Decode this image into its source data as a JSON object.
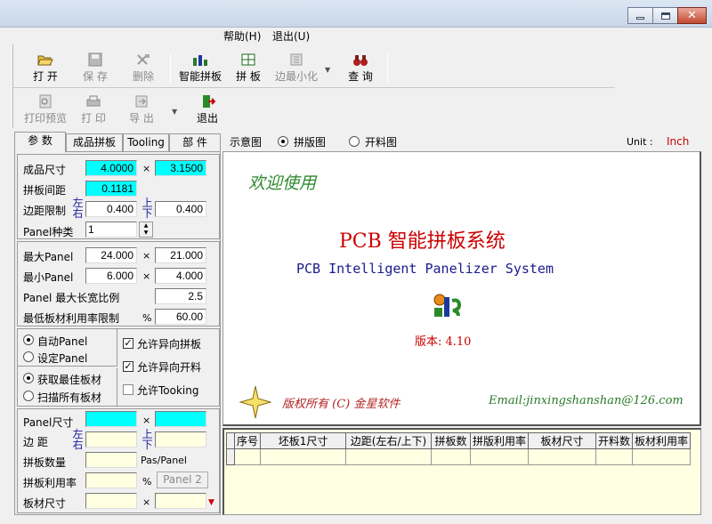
{
  "menu": {
    "help": "帮助(H)",
    "exit": "退出(U)"
  },
  "toolbar": {
    "open": "打 开",
    "save": "保 存",
    "delete": "删除",
    "smart_panel": "智能拼板",
    "panel": "拼 板",
    "edge_min": "边最小化",
    "query": "查 询",
    "print_preview": "打印预览",
    "print": "打 印",
    "export": "导 出",
    "exit": "退出"
  },
  "tabs": [
    "参 数",
    "成品拼板",
    "Tooling",
    "部 件"
  ],
  "params": {
    "product_size_label": "成品尺寸",
    "product_w": "4.0000",
    "product_h": "3.1500",
    "spacing_label": "拼板间距",
    "spacing": "0.1181",
    "edge_limit_label": "边距限制",
    "lr_label": "左右",
    "tb_label": "上下",
    "edge_lr": "0.400",
    "edge_tb": "0.400",
    "panel_types_label": "Panel种类",
    "panel_types": "1",
    "max_panel_label": "最大Panel",
    "max_w": "24.000",
    "max_h": "21.000",
    "min_panel_label": "最小Panel",
    "min_w": "6.000",
    "min_h": "4.000",
    "ratio_label": "Panel 最大长宽比例",
    "ratio": "2.5",
    "util_limit_label": "最低板材利用率限制",
    "percent": "%",
    "util_limit": "60.00",
    "times": "×"
  },
  "options": {
    "auto_panel": "自动Panel",
    "set_panel": "设定Panel",
    "allow_diff_panel": "允许异向拼板",
    "allow_diff_cut": "允许异向开料",
    "get_best_sheet": "获取最佳板材",
    "scan_all_sheets": "扫描所有板材",
    "allow_tooling": "允许Tooking"
  },
  "results": {
    "panel_size_label": "Panel尺寸",
    "edge_label": "边   距",
    "panel_count_label": "拼板数量",
    "pcs_panel": "Pas/Panel",
    "panel_util_label": "拼板利用率",
    "panel2_button": "Panel 2",
    "sheet_size_label": "板材尺寸"
  },
  "view": {
    "schematic": "示意图",
    "panel_view": "拼版图",
    "cutting_view": "开料图",
    "unit_label": "Unit :",
    "unit_value": "Inch"
  },
  "preview": {
    "welcome": "欢迎使用",
    "title_cn": "PCB 智能拼板系统",
    "title_en": "PCB Intelligent Panelizer System",
    "version": "版本: 4.10",
    "copyright": "版权所有 (C)  金星软件",
    "email": "Email:jinxingshanshan@126.com"
  },
  "table": {
    "headers": [
      "序号",
      "坯板1尺寸",
      "边距(左右/上下)",
      "拼板数",
      "拼版利用率",
      "板材尺寸",
      "开料数",
      "板材利用率"
    ]
  },
  "colors": {
    "cyan_field": "#00ffff",
    "pale_field": "#ffffe1",
    "brand_red": "#cc0000",
    "brand_blue": "#1a1a8c",
    "welcome_green": "#2d8a2d"
  }
}
